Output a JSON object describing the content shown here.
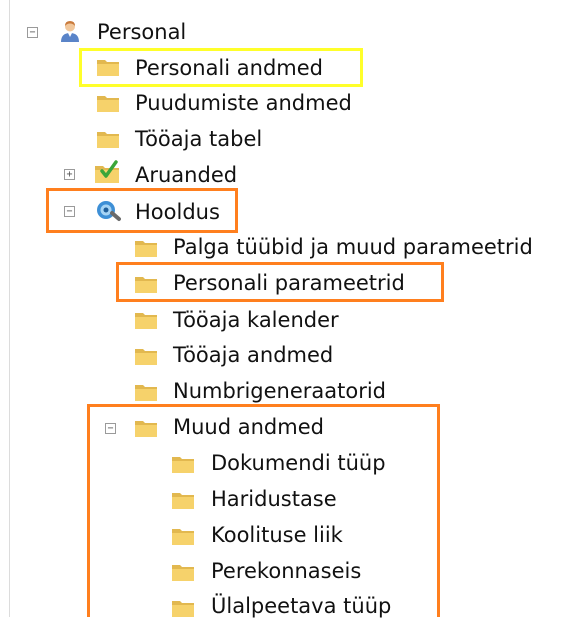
{
  "tree": {
    "root": {
      "label": "Personal",
      "icon": "user-icon",
      "children": [
        {
          "label": "Personali andmed",
          "icon": "folder-icon"
        },
        {
          "label": "Puudumiste andmed",
          "icon": "folder-icon"
        },
        {
          "label": "Tööaja tabel",
          "icon": "folder-icon"
        },
        {
          "label": "Aruanded",
          "icon": "reports-icon",
          "toggle": "+"
        },
        {
          "label": "Hooldus",
          "icon": "maintenance-icon",
          "toggle": "−",
          "children": [
            {
              "label": "Palga tüübid ja muud parameetrid",
              "icon": "folder-icon"
            },
            {
              "label": "Personali parameetrid",
              "icon": "folder-icon"
            },
            {
              "label": "Tööaja kalender",
              "icon": "folder-icon"
            },
            {
              "label": "Tööaja andmed",
              "icon": "folder-icon"
            },
            {
              "label": "Numbrigeneraatorid",
              "icon": "folder-icon"
            },
            {
              "label": "Muud andmed",
              "icon": "folder-icon",
              "toggle": "−",
              "children": [
                {
                  "label": "Dokumendi tüüp",
                  "icon": "folder-icon"
                },
                {
                  "label": "Haridustase",
                  "icon": "folder-icon"
                },
                {
                  "label": "Koolituse liik",
                  "icon": "folder-icon"
                },
                {
                  "label": "Perekonnaseis",
                  "icon": "folder-icon"
                },
                {
                  "label": "Ülalpeetava tüüp",
                  "icon": "folder-icon"
                }
              ]
            }
          ]
        }
      ],
      "toggle": "−"
    }
  },
  "colors": {
    "highlight_yellow": "#ffff2a",
    "highlight_orange": "#ff7f1e",
    "folder": "#f6d26b"
  }
}
